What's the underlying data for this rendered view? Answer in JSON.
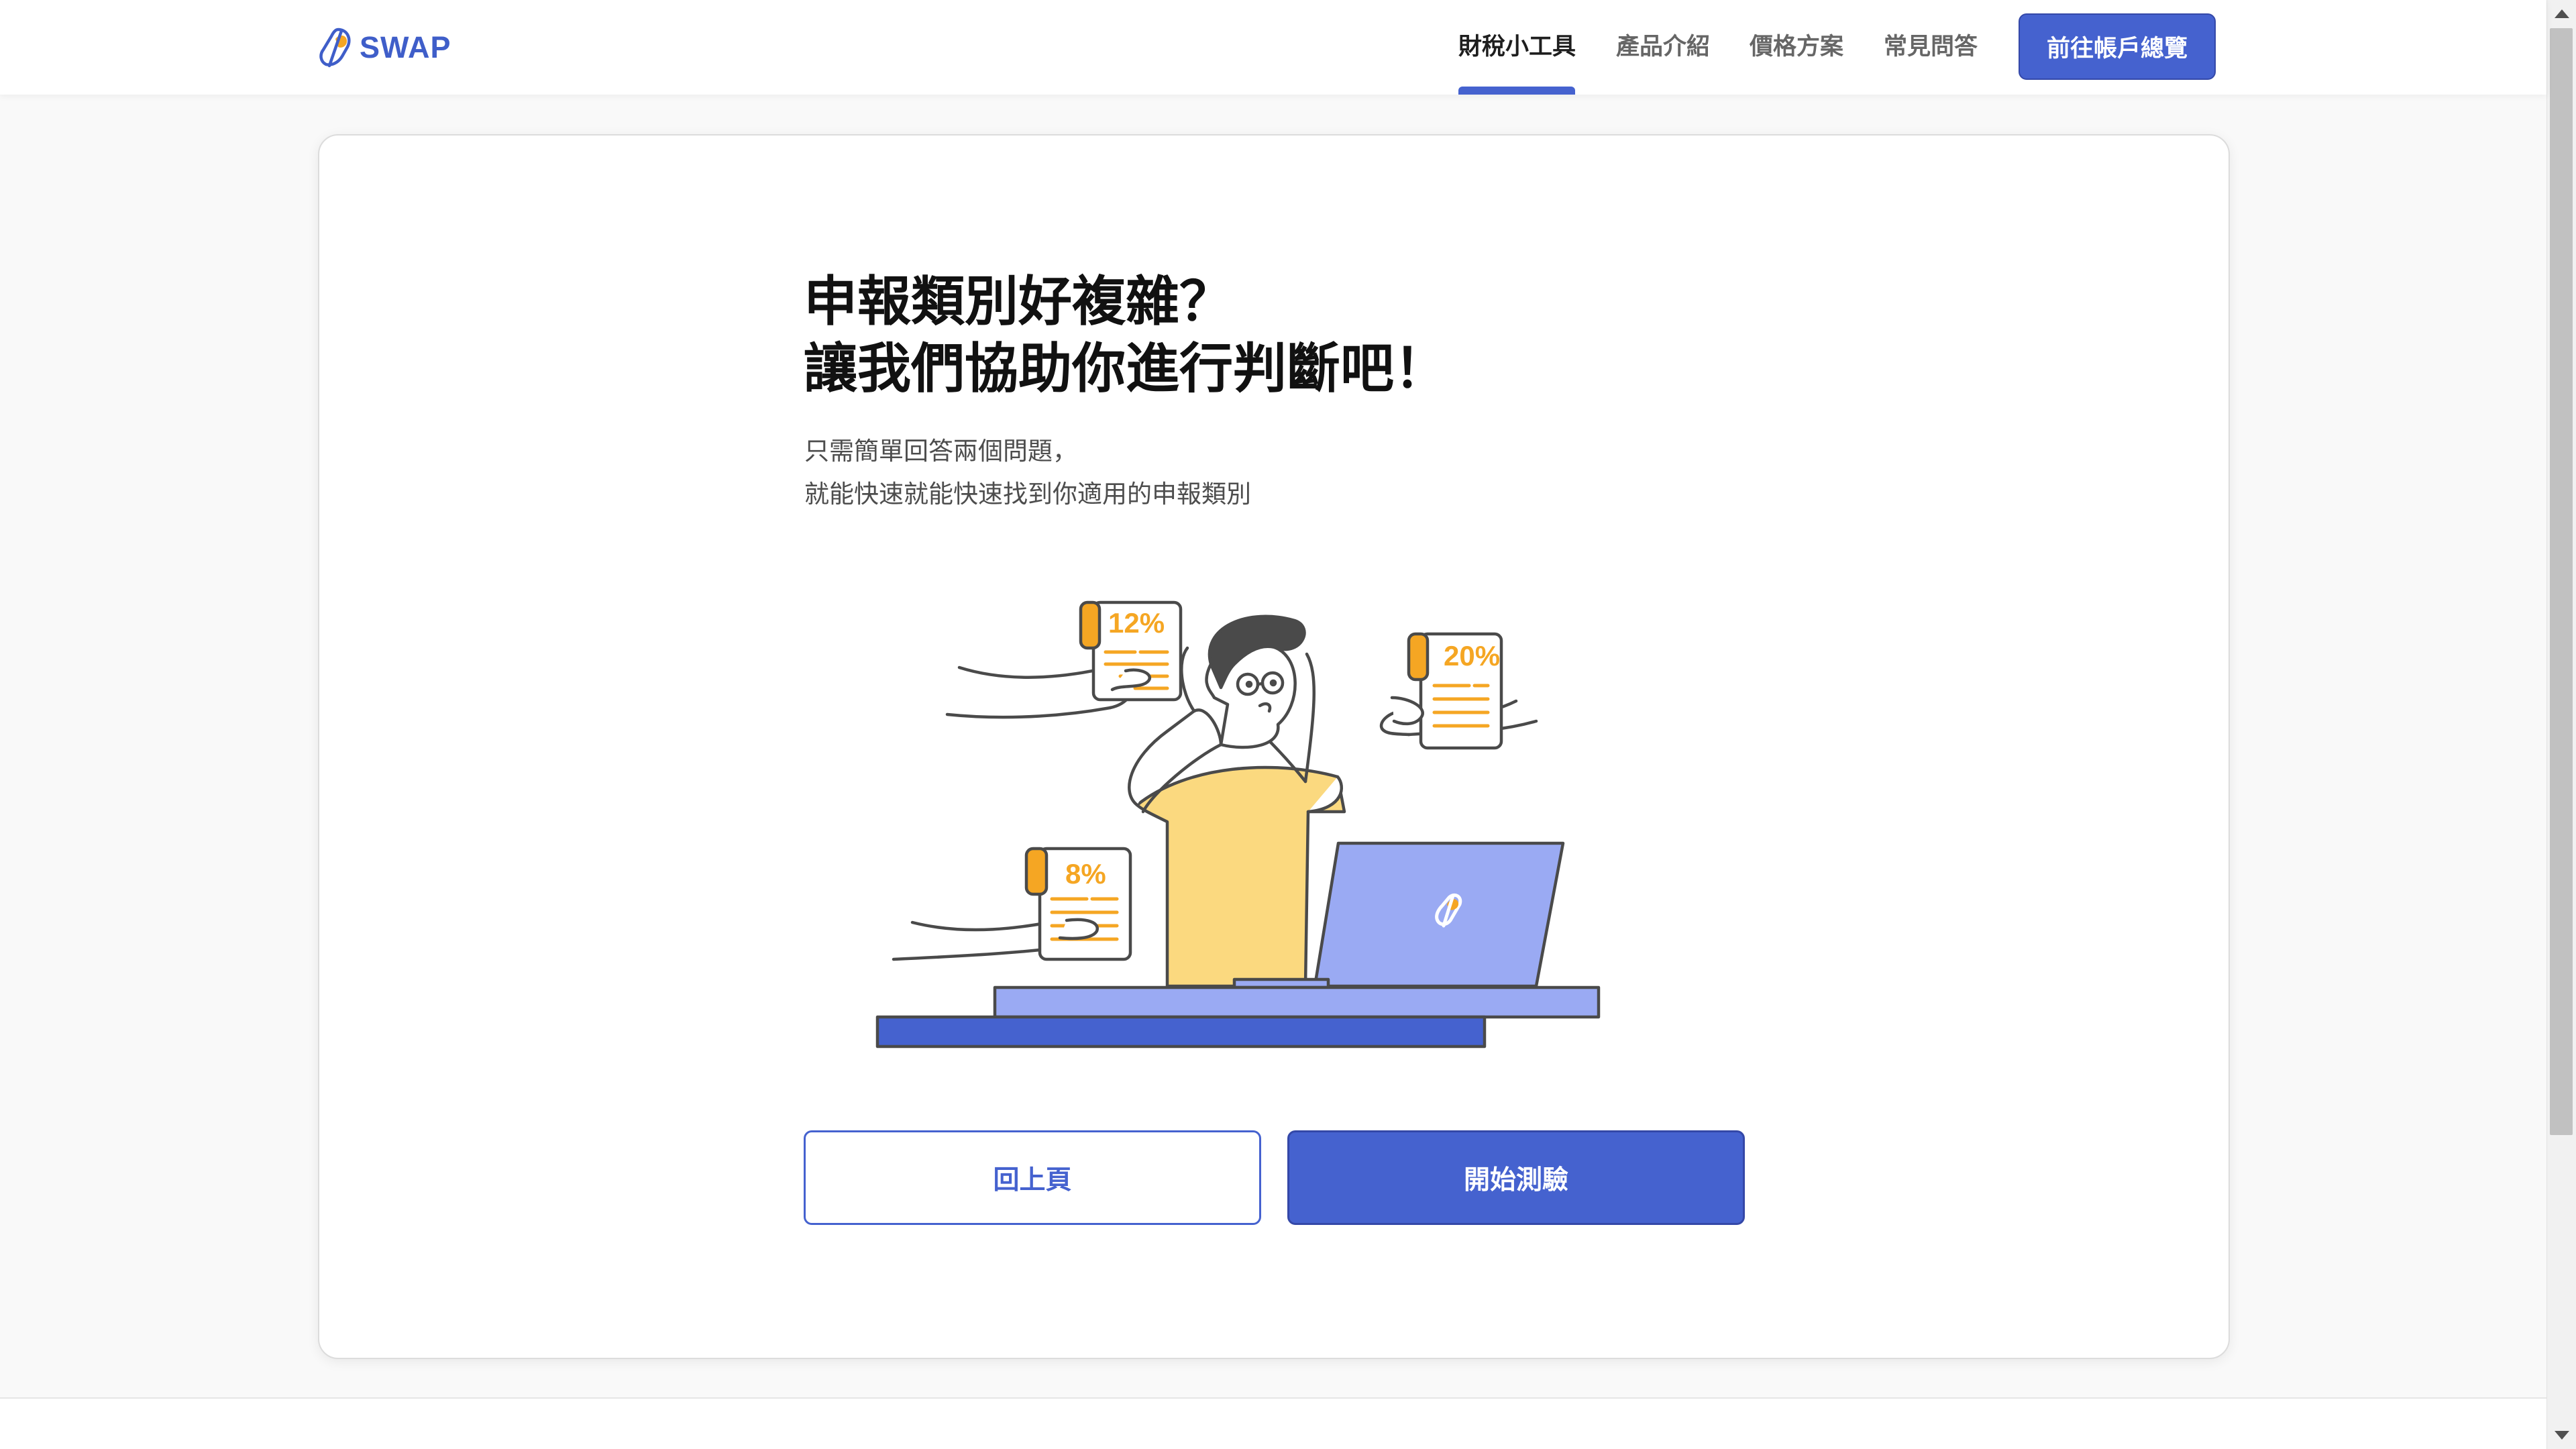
{
  "header": {
    "logo_text": "SWAP",
    "nav": [
      {
        "label": "財稅小工具",
        "active": true
      },
      {
        "label": "產品介紹",
        "active": false
      },
      {
        "label": "價格方案",
        "active": false
      },
      {
        "label": "常見問答",
        "active": false
      }
    ],
    "account_button": "前往帳戶總覽"
  },
  "main": {
    "title_line1": "申報類別好複雜？",
    "title_line2": "讓我們協助你進行判斷吧！",
    "subtitle_line1": "只需簡單回答兩個問題，",
    "subtitle_line2": "就能快速就能快速找到你適用的申報類別",
    "illustration": {
      "doc_left_top": "12%",
      "doc_right": "20%",
      "doc_left_bottom": "8%"
    },
    "back_button": "回上頁",
    "start_button": "開始測驗"
  },
  "colors": {
    "brand_blue": "#4562cf",
    "accent_orange": "#f5a623",
    "shirt_yellow": "#fbd97f",
    "laptop_blue": "#9aaaf3"
  }
}
